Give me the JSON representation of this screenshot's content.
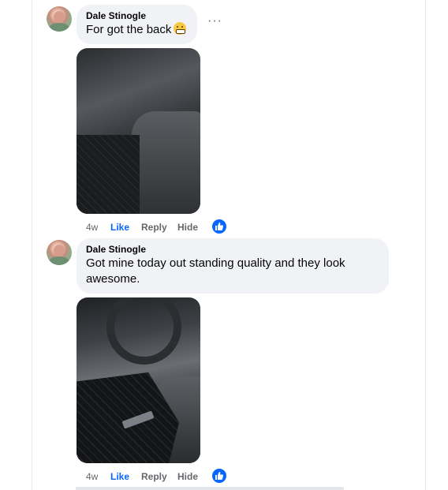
{
  "comments": [
    {
      "author": "Dale Stinogle",
      "text": "For got the back",
      "emoji_icon": "grinning-face-emoji",
      "more_label": "···",
      "photo": "black leather car seat with quilted floor mat",
      "actions": {
        "age": "4w",
        "like": "Like",
        "reply": "Reply",
        "hide": "Hide"
      },
      "reaction_icon": "like-reaction-icon"
    },
    {
      "author": "Dale Stinogle",
      "text_lines": [
        "Got mine today out standing quality and they look",
        "awesome."
      ],
      "photo": "car interior with quilted black floor mat under steering wheel",
      "actions": {
        "age": "4w",
        "like": "Like",
        "reply": "Reply",
        "hide": "Hide"
      },
      "reaction_icon": "like-reaction-icon"
    }
  ],
  "colors": {
    "accent": "#0866ff",
    "bubble": "#f0f2f5",
    "muted": "#65676b"
  }
}
